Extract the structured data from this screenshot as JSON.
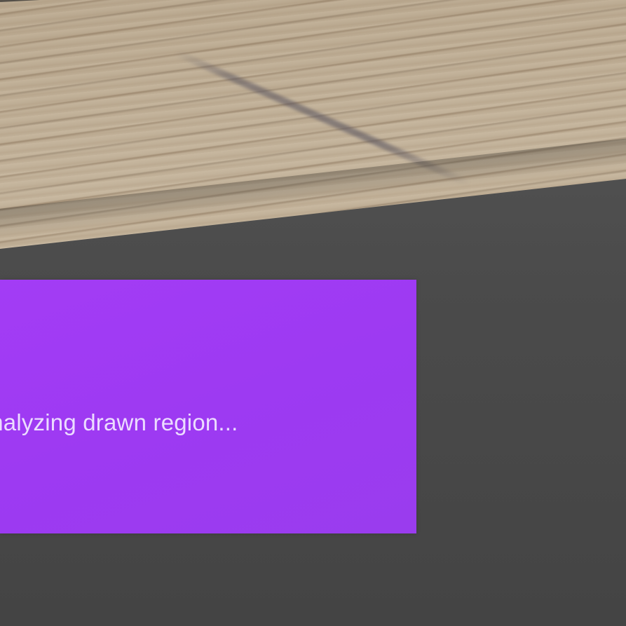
{
  "status_panel": {
    "message": "Analyzing drawn region...",
    "background_color": "#a13cf4",
    "text_color": "#ecdcff"
  },
  "background": {
    "camera_view": "wooden-table-surface",
    "device_color": "#4a4a4a"
  }
}
